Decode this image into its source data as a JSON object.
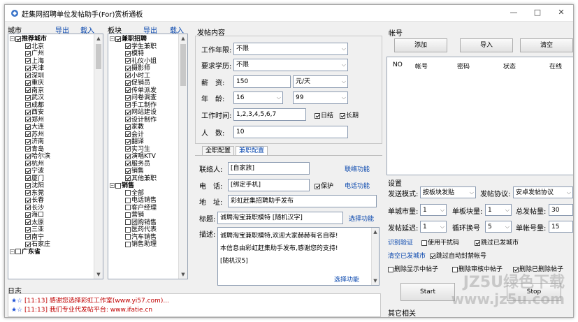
{
  "window": {
    "title": "赶集网招聘单位发帖助手(For)赏析通板",
    "min": "—",
    "max": "□",
    "close": "✕"
  },
  "city_header": {
    "label": "城市",
    "export": "导出",
    "import": "载入"
  },
  "cities": [
    {
      "label": "推荐城市",
      "root": true
    },
    {
      "label": "北京"
    },
    {
      "label": "广州"
    },
    {
      "label": "上海"
    },
    {
      "label": "天津"
    },
    {
      "label": "深圳"
    },
    {
      "label": "重庆"
    },
    {
      "label": "南京"
    },
    {
      "label": "武汉"
    },
    {
      "label": "成都"
    },
    {
      "label": "西安"
    },
    {
      "label": "郑州"
    },
    {
      "label": "大连"
    },
    {
      "label": "苏州"
    },
    {
      "label": "济南"
    },
    {
      "label": "青岛"
    },
    {
      "label": "哈尔滨"
    },
    {
      "label": "杭州"
    },
    {
      "label": "宁波"
    },
    {
      "label": "厦门"
    },
    {
      "label": "沈阳"
    },
    {
      "label": "东莞"
    },
    {
      "label": "长春"
    },
    {
      "label": "长沙"
    },
    {
      "label": "海口"
    },
    {
      "label": "太原"
    },
    {
      "label": "三亚"
    },
    {
      "label": "南宁"
    },
    {
      "label": "石家庄"
    },
    {
      "label": "广东省",
      "root": true,
      "partial": true
    }
  ],
  "board_header": {
    "label": "板块",
    "export": "导出",
    "import": "载入"
  },
  "boards": [
    {
      "label": "兼职招聘",
      "root": true
    },
    {
      "label": "学生兼职"
    },
    {
      "label": "模特"
    },
    {
      "label": "礼仪小姐"
    },
    {
      "label": "摄影师"
    },
    {
      "label": "小时工"
    },
    {
      "label": "促销员"
    },
    {
      "label": "传单派发"
    },
    {
      "label": "问卷调查"
    },
    {
      "label": "手工制作"
    },
    {
      "label": "网站建设"
    },
    {
      "label": "设计制作"
    },
    {
      "label": "家教"
    },
    {
      "label": "会计"
    },
    {
      "label": "翻译"
    },
    {
      "label": "实习生"
    },
    {
      "label": "演唱KTV"
    },
    {
      "label": "服务员"
    },
    {
      "label": "销售"
    },
    {
      "label": "其他兼职"
    },
    {
      "label": "销售",
      "root": true,
      "unchecked": true
    },
    {
      "label": "全部",
      "unchecked": true
    },
    {
      "label": "电话销售",
      "unchecked": true
    },
    {
      "label": "客户经理",
      "unchecked": true
    },
    {
      "label": "营销",
      "unchecked": true
    },
    {
      "label": "团购销售",
      "unchecked": true
    },
    {
      "label": "医药代表",
      "unchecked": true
    },
    {
      "label": "汽车销售",
      "unchecked": true
    },
    {
      "label": "销售助理",
      "unchecked": true
    }
  ],
  "post": {
    "header": "发帖内容",
    "work_years_label": "工作年限:",
    "work_years_value": "不限",
    "education_label": "要求学历:",
    "education_value": "不限",
    "salary_label": "薪　资:",
    "salary_value": "150",
    "salary_unit": "元/天",
    "age_label": "年　龄:",
    "age_from": "16",
    "age_to": "99",
    "worktime_label": "工作时间:",
    "worktime_value": "1,2,3,4,5,6,7",
    "daily_label": "日结",
    "longterm_label": "长期",
    "people_label": "人　数:",
    "people_value": "10",
    "tab_fulltime": "全职配置",
    "tab_parttime": "兼职配置",
    "contact_label": "联络人:",
    "contact_value": "[自家族]",
    "contact_fn": "联络功能",
    "phone_label": "电　话:",
    "phone_value": "[绑定手机]",
    "protect_label": "保护",
    "phone_fn": "电话功能",
    "address_label": "地　址:",
    "address_value": "彩虹赶集招聘助手发布",
    "title_label": "标题:",
    "title_value": "诚聘淘宝兼职模特 [随机汉字]",
    "title_fn": "选择功能",
    "desc_label": "描述:",
    "desc_lines": [
      "诚聘淘宝兼职模特,欢迎大家赫赫有名自荐!",
      "本信息由彩虹赶集助手发布,感谢您的支持!",
      "[随机汉5]"
    ],
    "desc_fn": "选择功能"
  },
  "account": {
    "header": "帐号",
    "add": "添加",
    "import": "导入",
    "clear": "清空",
    "columns": [
      "NO",
      "帐号",
      "密码",
      "状态",
      "在线"
    ]
  },
  "settings": {
    "header": "设置",
    "send_mode_label": "发送模式:",
    "send_mode_value": "按板块发贴",
    "protocol_label": "发帖协议:",
    "protocol_value": "安卓发帖协议",
    "city_count_label": "单城市量:",
    "city_count_value": "1",
    "board_count_label": "单板块量:",
    "board_count_value": "1",
    "total_label": "总发帖量:",
    "total_value": "30",
    "delay_label": "发帖延迟:",
    "delay_value": "1",
    "switch_label": "循环换号",
    "switch_value": "5",
    "single_label": "单帐号量:",
    "single_value": "15",
    "captcha_fn": "识别验证",
    "use_proxy": "使用干扰码",
    "skip_city": "跳过已发城市",
    "clear_city": "清空已发城市",
    "skip_banned": "跳过自动封禁帐号",
    "del_show": "删除显示中帖子",
    "del_review": "删除审核中帖子",
    "del_deleted": "删除已删除帖子",
    "start": "Start",
    "stop": "Stop",
    "other": "其它相关"
  },
  "log": {
    "header": "日志",
    "lines": [
      {
        "star": "★☆",
        "text": "[11:13] 感谢您选择彩虹工作室(www.yi57.com)..."
      },
      {
        "star": "★☆",
        "text": "[11:13] 我们专业代发帖平台: www.ifatie.cn"
      }
    ]
  },
  "watermark": {
    "line1": "JZ5U绿色下载",
    "line2": "www.jz5u.com"
  }
}
